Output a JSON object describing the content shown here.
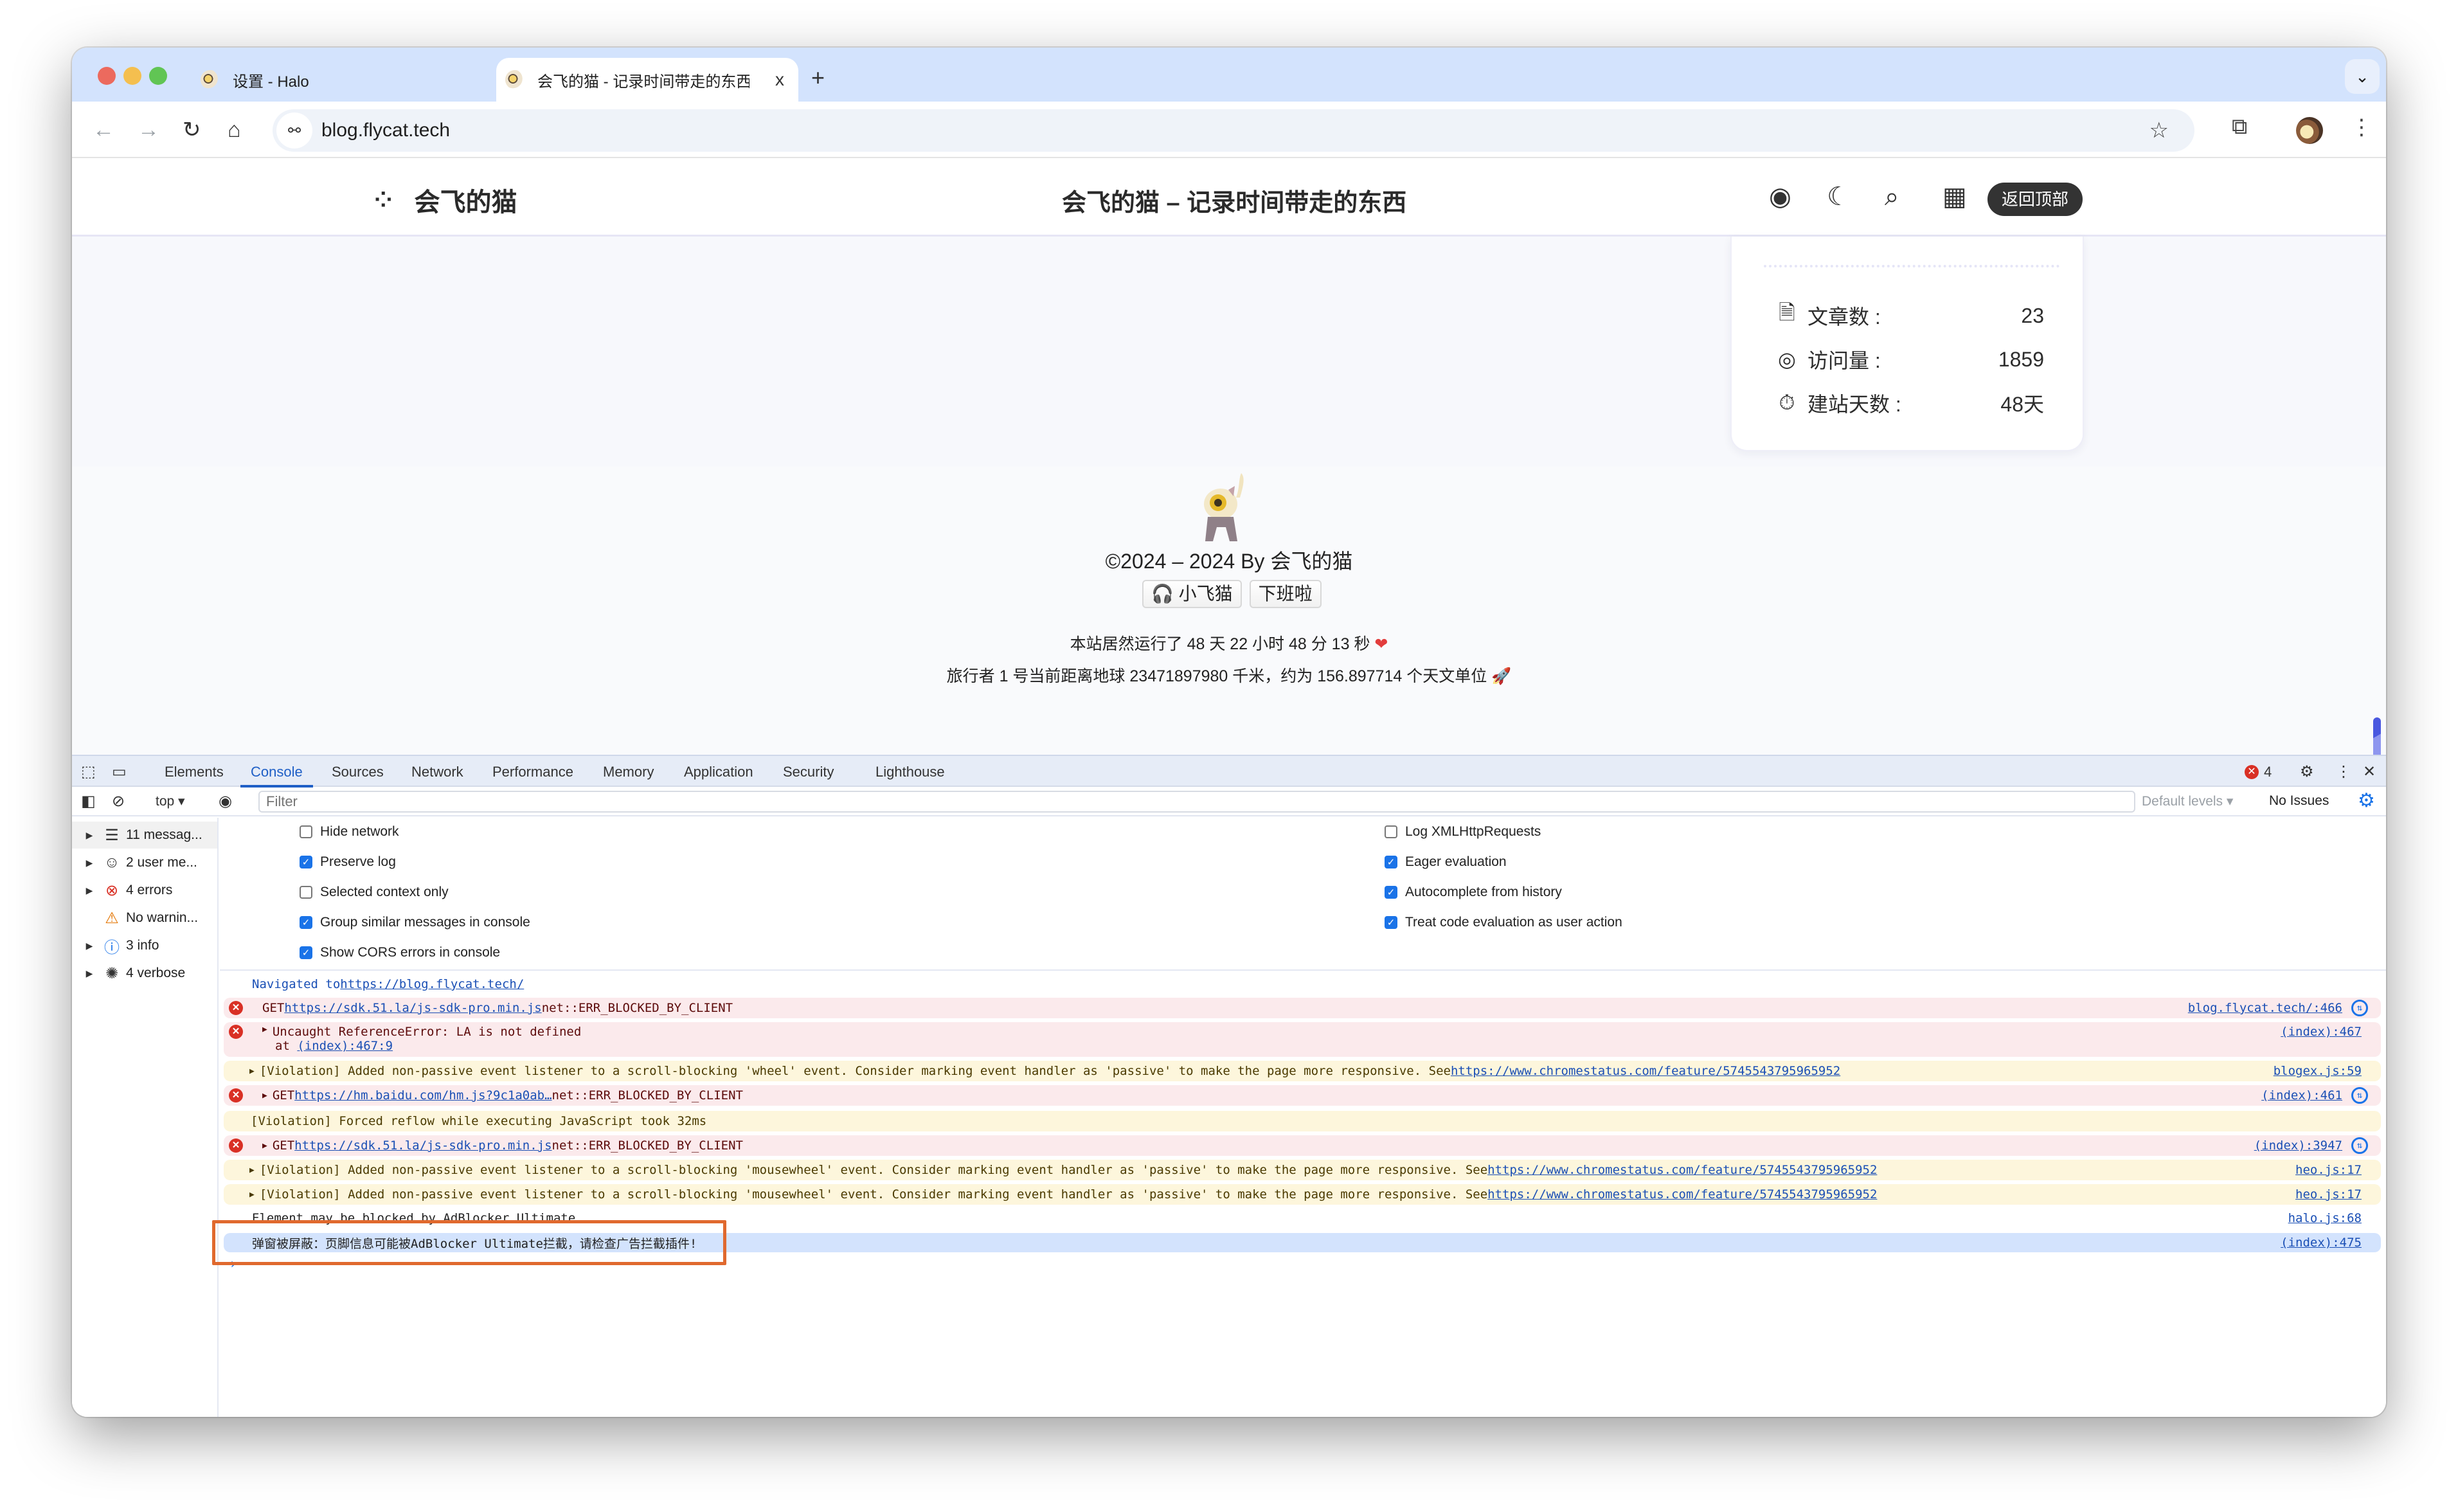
{
  "browser": {
    "tabs": [
      {
        "title": "设置 - Halo",
        "active": false
      },
      {
        "title": "会飞的猫 - 记录时间带走的东西",
        "active": true
      }
    ],
    "close_glyph": "x",
    "new_tab_glyph": "+",
    "tab_menu_glyph": "⌄",
    "address": "blog.flycat.tech",
    "nav": {
      "back": "←",
      "forward": "→",
      "reload": "↻",
      "home": "⌂"
    },
    "icons": {
      "site_info": "⚯",
      "bookmark": "☆",
      "extensions": "⧉",
      "menu": "⋮"
    }
  },
  "site": {
    "brand": "会飞的猫",
    "brand_icon": "⁘",
    "title": "会飞的猫 – 记录时间带走的东西",
    "header_icons": {
      "rss": "◉",
      "dark_mode": "☾",
      "search": "⌕",
      "apps": "▦"
    },
    "back_to_top": "返回顶部",
    "stats": [
      {
        "icon": "🗎",
        "label": "文章数 :",
        "value": "23"
      },
      {
        "icon": "◎",
        "label": "访问量 :",
        "value": "1859"
      },
      {
        "icon": "⏱",
        "label": "建站天数 :",
        "value": "48天"
      }
    ],
    "footer": {
      "copyright": "©2024 – 2024 By 会飞的猫",
      "badges": [
        "🎧 小飞猫",
        "下班啦"
      ],
      "runtime": "本站居然运行了 48 天 22 小时 48 分 13 秒",
      "heart": "❤",
      "voyager": "旅行者 1 号当前距离地球 23471897980 千米，约为 156.897714 个天文单位",
      "rocket": "🚀"
    }
  },
  "devtools": {
    "panel_icons": {
      "inspect": "⬚",
      "device": "▭"
    },
    "tabs": [
      "Elements",
      "Console",
      "Sources",
      "Network",
      "Performance",
      "Memory",
      "Application",
      "Security",
      "Lighthouse"
    ],
    "active_tab": "Console",
    "error_count": "4",
    "icons": {
      "settings": "⚙",
      "more": "⋮",
      "close": "✕",
      "sidebar": "◧",
      "clear": "⊘",
      "eye": "◉"
    },
    "context": "top ▾",
    "filter_placeholder": "Filter",
    "default_levels": "Default levels ▾",
    "no_issues": "No Issues",
    "sidebar": [
      {
        "icon": "☰",
        "label": "11 messag...",
        "expandable": true,
        "color": "#333333"
      },
      {
        "icon": "☺",
        "label": "2 user me...",
        "expandable": true,
        "color": "#333333"
      },
      {
        "icon": "⊗",
        "label": "4 errors",
        "expandable": true,
        "color": "#d93025"
      },
      {
        "icon": "⚠",
        "label": "No warnin...",
        "expandable": false,
        "color": "#e37400"
      },
      {
        "icon": "ⓘ",
        "label": "3 info",
        "expandable": true,
        "color": "#1a73e8"
      },
      {
        "icon": "✺",
        "label": "4 verbose",
        "expandable": true,
        "color": "#333333"
      }
    ],
    "settings_left": [
      {
        "label": "Hide network",
        "checked": false
      },
      {
        "label": "Preserve log",
        "checked": true
      },
      {
        "label": "Selected context only",
        "checked": false
      },
      {
        "label": "Group similar messages in console",
        "checked": true
      },
      {
        "label": "Show CORS errors in console",
        "checked": true
      }
    ],
    "settings_right": [
      {
        "label": "Log XMLHttpRequests",
        "checked": false
      },
      {
        "label": "Eager evaluation",
        "checked": true
      },
      {
        "label": "Autocomplete from history",
        "checked": true
      },
      {
        "label": "Treat code evaluation as user action",
        "checked": true
      }
    ],
    "messages": [
      {
        "level": "info",
        "text": "Navigated to ",
        "link": "https://blog.flycat.tech/",
        "rest": "",
        "source": "",
        "network": false
      },
      {
        "level": "error",
        "expand": false,
        "text": "GET ",
        "link": "https://sdk.51.la/js-sdk-pro.min.js",
        "rest": " net::ERR_BLOCKED_BY_CLIENT",
        "source": "blog.flycat.tech/:466",
        "network": true
      },
      {
        "level": "error",
        "expand": true,
        "text": "Uncaught ReferenceError: LA is not defined",
        "link": "",
        "rest": "",
        "line2": "at ",
        "line2_link": "(index):467:9",
        "source": "(index):467",
        "network": false
      },
      {
        "level": "warning",
        "expand": true,
        "text": "[Violation] Added non-passive event listener to a scroll-blocking 'wheel' event. Consider marking event handler as 'passive' to make the page more responsive. See ",
        "link": "https://www.chromestatus.com/feature/5745543795965952",
        "rest": "",
        "source": "blogex.js:59",
        "network": false
      },
      {
        "level": "error",
        "expand": true,
        "text": "GET ",
        "link": "https://hm.baidu.com/hm.js?9c1a0ab…",
        "rest": " net::ERR_BLOCKED_BY_CLIENT",
        "source": "(index):461",
        "network": true
      },
      {
        "level": "warning",
        "expand": false,
        "text": "[Violation] Forced reflow while executing JavaScript took 32ms",
        "link": "",
        "rest": "",
        "source": "",
        "network": false
      },
      {
        "level": "error",
        "expand": true,
        "text": "GET ",
        "link": "https://sdk.51.la/js-sdk-pro.min.js",
        "rest": " net::ERR_BLOCKED_BY_CLIENT",
        "source": "(index):3947",
        "network": true
      },
      {
        "level": "warning",
        "expand": true,
        "text": "[Violation] Added non-passive event listener to a scroll-blocking 'mousewheel' event. Consider marking event handler as 'passive' to make the page more responsive. See ",
        "link": "https://www.chromestatus.com/feature/5745543795965952",
        "rest": "",
        "source": "heo.js:17",
        "network": false
      },
      {
        "level": "warning",
        "expand": true,
        "text": "[Violation] Added non-passive event listener to a scroll-blocking 'mousewheel' event. Consider marking event handler as 'passive' to make the page more responsive. See ",
        "link": "https://www.chromestatus.com/feature/5745543795965952",
        "rest": "",
        "source": "heo.js:17",
        "network": false
      },
      {
        "level": "log",
        "expand": false,
        "text": "Element may be blocked by AdBlocker Ultimate",
        "link": "",
        "rest": "",
        "source": "halo.js:68",
        "network": false
      },
      {
        "level": "selected",
        "expand": false,
        "text": "弹窗被屏蔽：页脚信息可能被AdBlocker Ultimate拦截，请检查广告拦截插件!",
        "link": "",
        "rest": "",
        "source": "(index):475",
        "network": false
      }
    ],
    "prompt": "›"
  },
  "colors": {
    "tabstrip": "#d3e3fd",
    "accent_blue": "#1a73e8",
    "error_red": "#d93025",
    "highlight_orange": "#e0692e"
  }
}
